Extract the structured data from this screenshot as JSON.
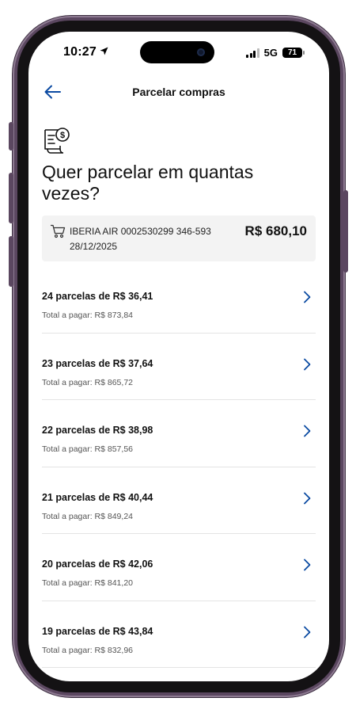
{
  "status_bar": {
    "time": "10:27",
    "network": "5G",
    "battery": "71"
  },
  "header": {
    "title": "Parcelar compras"
  },
  "question": "Quer parcelar em quantas vezes?",
  "purchase": {
    "description": "IBERIA AIR 0002530299 346-593",
    "date": "28/12/2025",
    "amount": "R$ 680,10"
  },
  "options": [
    {
      "title": "24 parcelas de R$ 36,41",
      "total": "Total a pagar: R$ 873,84"
    },
    {
      "title": "23 parcelas de R$ 37,64",
      "total": "Total a pagar: R$ 865,72"
    },
    {
      "title": "22 parcelas de R$ 38,98",
      "total": "Total a pagar: R$ 857,56"
    },
    {
      "title": "21 parcelas de R$ 40,44",
      "total": "Total a pagar: R$ 849,24"
    },
    {
      "title": "20 parcelas de R$ 42,06",
      "total": "Total a pagar: R$ 841,20"
    },
    {
      "title": "19 parcelas de R$ 43,84",
      "total": "Total a pagar: R$ 832,96"
    }
  ],
  "colors": {
    "accent": "#0b4aa2",
    "frame": "#5b4760",
    "card_bg": "#f3f3f3"
  },
  "icons": {
    "back": "arrow-left-icon",
    "document": "invoice-dollar-icon",
    "cart": "cart-icon",
    "chevron": "chevron-right-icon"
  }
}
